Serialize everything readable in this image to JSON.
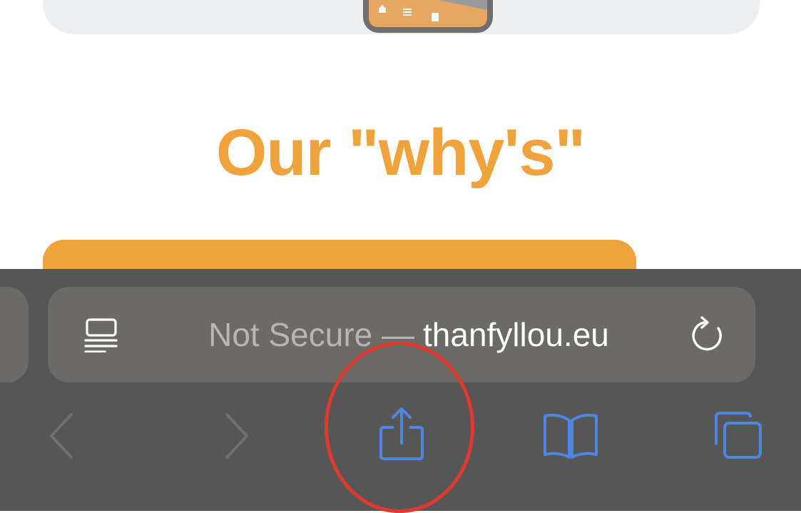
{
  "page": {
    "heading": "Our \"why's\""
  },
  "browser": {
    "url_bar": {
      "security_label": "Not Secure —",
      "domain": "thanfyllou.eu"
    },
    "toolbar": {
      "icons": [
        "back-chevron-icon",
        "forward-chevron-icon",
        "share-icon",
        "bookmarks-book-icon",
        "tabs-icon"
      ]
    }
  },
  "colors": {
    "accent_orange": "#f0a23c",
    "toolbar_bg": "#565656",
    "url_bar_bg": "#6c6a67",
    "ios_blue": "#4f86e6",
    "disabled_gray": "#6f6f6f",
    "annotation_red": "#e2392f"
  }
}
